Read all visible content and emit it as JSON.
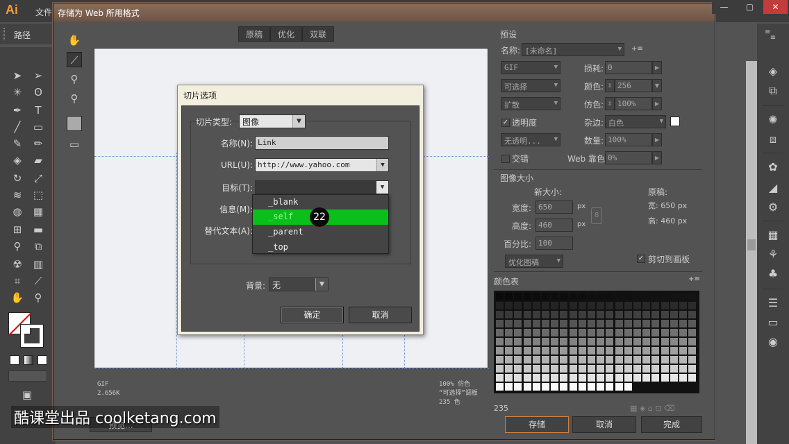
{
  "app": {
    "logo": "Ai",
    "menu_file": "文件",
    "control_label": "路径"
  },
  "dialog": {
    "title": "存储为 Web 所用格式",
    "tabs": [
      "原稿",
      "优化",
      "双联"
    ],
    "info_left": [
      "GIF",
      "2.656K"
    ],
    "info_right": [
      "100% 仿色",
      "“可选择”调板",
      "235 色"
    ],
    "preview_btn": "预览...",
    "preset": {
      "section": "预设",
      "name_label": "名称:",
      "name_value": "[未命名]",
      "format": "GIF",
      "loss_label": "损耗:",
      "loss_value": "0",
      "reduction": "可选择",
      "colors_label": "颜色:",
      "colors_value": "256",
      "dither_algo": "扩散",
      "dither_label": "仿色:",
      "dither_value": "100%",
      "transparency_label": "透明度",
      "transparency_checked": true,
      "matte_label": "杂边:",
      "matte_value": "白色",
      "trans_dither": "无透明...",
      "amount_label": "数量:",
      "amount_value": "100%",
      "interlaced_label": "交错",
      "websnap_label": "Web 靠色:",
      "websnap_value": "0%"
    },
    "image_size": {
      "section": "图像大小",
      "new_size": "新大小:",
      "original": "原稿:",
      "width_label": "宽度:",
      "width_value": "650",
      "height_label": "高度:",
      "height_value": "460",
      "percent_label": "百分比:",
      "percent_value": "100",
      "unit": "px",
      "orig_w": "宽: 650 px",
      "orig_h": "高: 460 px",
      "quality": "优化图稿",
      "clip_label": "剪切到画板",
      "clip_checked": true
    },
    "color_table": {
      "section": "颜色表",
      "count": "235"
    },
    "buttons": {
      "save": "存储",
      "cancel": "取消",
      "done": "完成"
    }
  },
  "slice_options": {
    "title": "切片选项",
    "type_label": "切片类型:",
    "type_value": "图像",
    "name_label": "名称(N):",
    "name_value": "Link",
    "url_label": "URL(U):",
    "url_value": "http://www.yahoo.com",
    "target_label": "目标(T):",
    "target_value": "",
    "message_label": "信息(M):",
    "alt_label": "替代文本(A):",
    "bg_label": "背景:",
    "bg_value": "无",
    "ok": "确定",
    "cancel": "取消",
    "target_options": [
      "_blank",
      "_self",
      "_parent",
      "_top"
    ]
  },
  "step_badge": "22",
  "watermark": "酷课堂出品 coolketang.com",
  "colors": {
    "accent_green": "#0bbf1b",
    "title_brown": "#7c5f4f",
    "panel": "#535353"
  }
}
